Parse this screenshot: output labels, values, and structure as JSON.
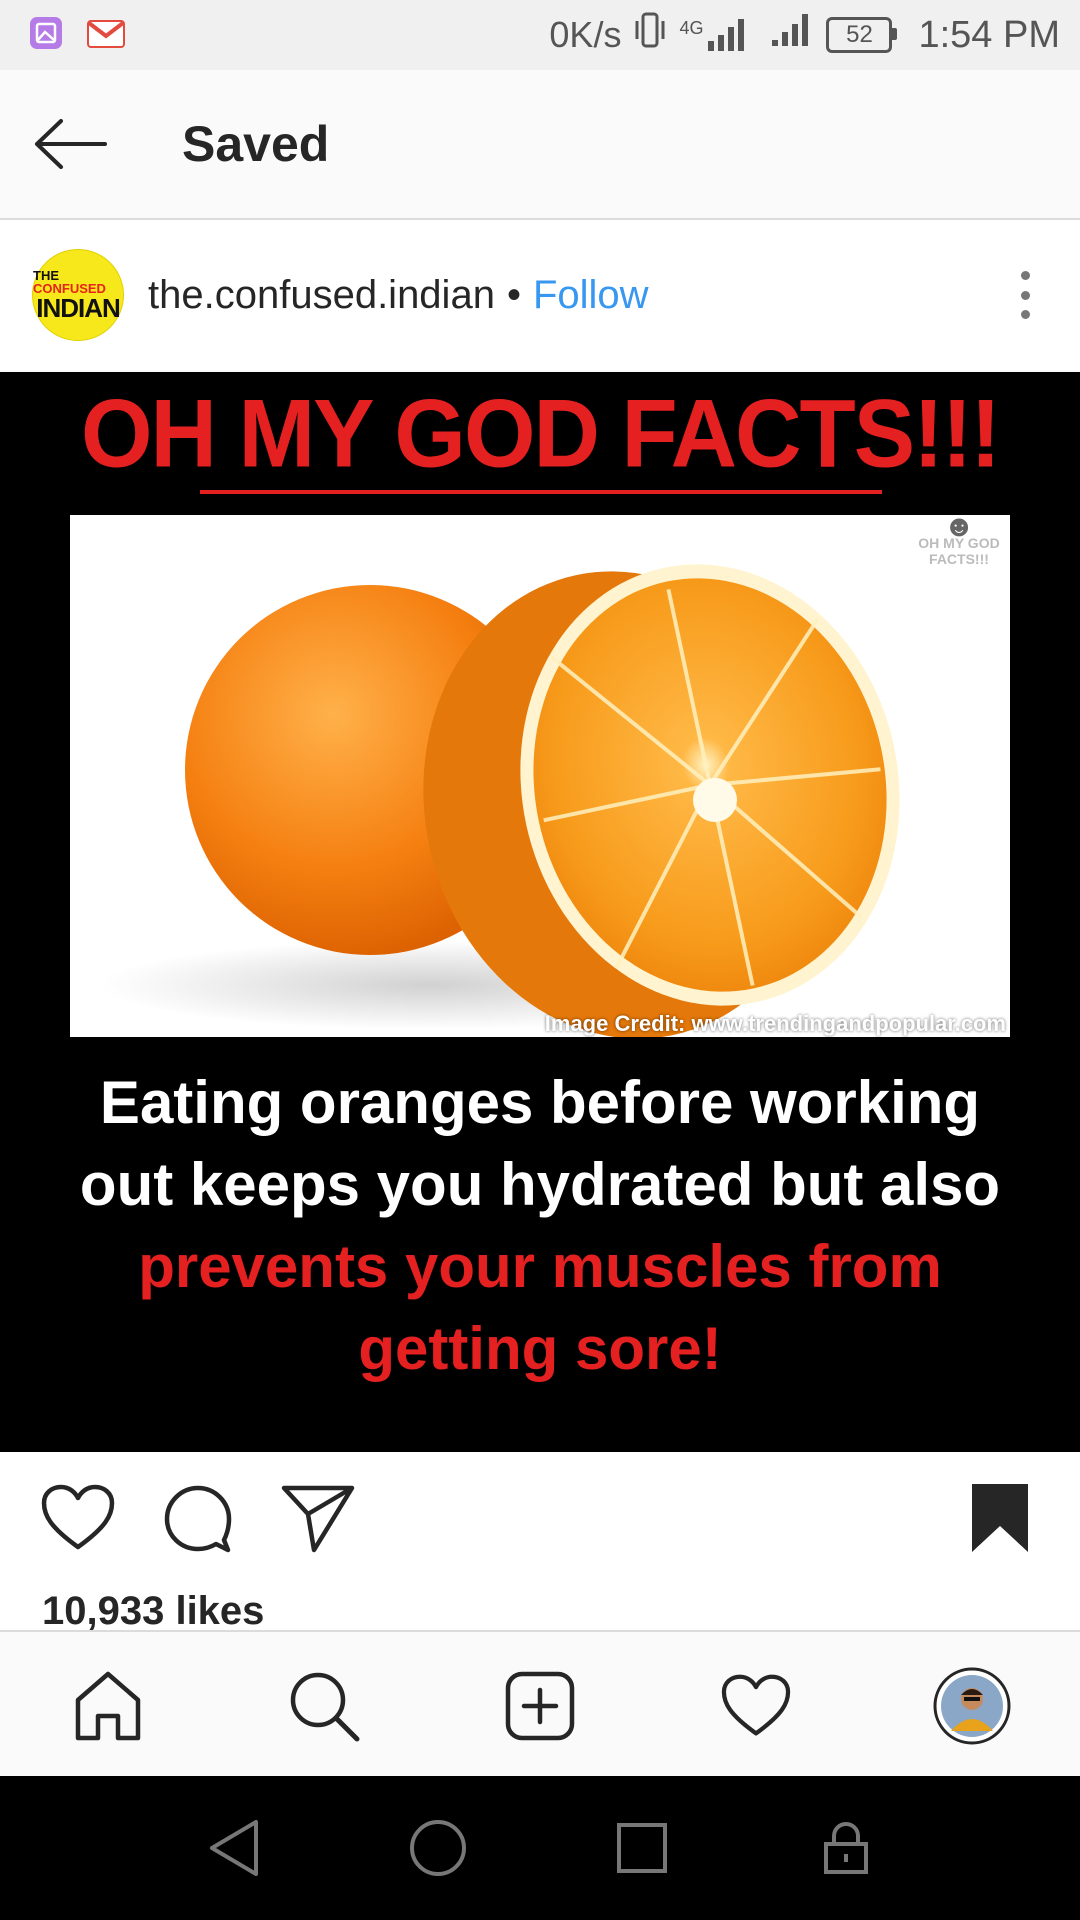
{
  "status_bar": {
    "net_speed": "0K/s",
    "network": "4G",
    "battery": "52",
    "time": "1:54 PM"
  },
  "header": {
    "title": "Saved"
  },
  "post": {
    "avatar_top": "THE",
    "avatar_top_accent": "CONFUSED",
    "avatar_main": "INDIAN",
    "username": "the.confused.indian",
    "separator": "•",
    "follow_label": "Follow",
    "image": {
      "banner": "OH MY GOD FACTS!!!",
      "watermark_line1": "OH MY GOD",
      "watermark_line2": "FACTS!!!",
      "credit": "Image Credit: www.trendingandpopular.com",
      "caption_line1": "Eating oranges before working",
      "caption_line2": "out keeps you hydrated but also",
      "caption_line3": "prevents your muscles from",
      "caption_line4": "getting sore!"
    },
    "likes": "10,933 likes"
  },
  "icons": {
    "back": "back-arrow-icon",
    "more": "more-vertical-icon",
    "like": "heart-icon",
    "comment": "comment-icon",
    "share": "send-icon",
    "saved": "bookmark-filled-icon",
    "nav": [
      "home-icon",
      "search-icon",
      "add-post-icon",
      "activity-heart-icon",
      "profile-avatar"
    ],
    "system": [
      "back-triangle-icon",
      "home-circle-icon",
      "recents-square-icon",
      "lock-icon"
    ]
  },
  "colors": {
    "accent": "#3897f0",
    "banner_red": "#e52020",
    "avatar_yellow": "#f6e81a"
  }
}
